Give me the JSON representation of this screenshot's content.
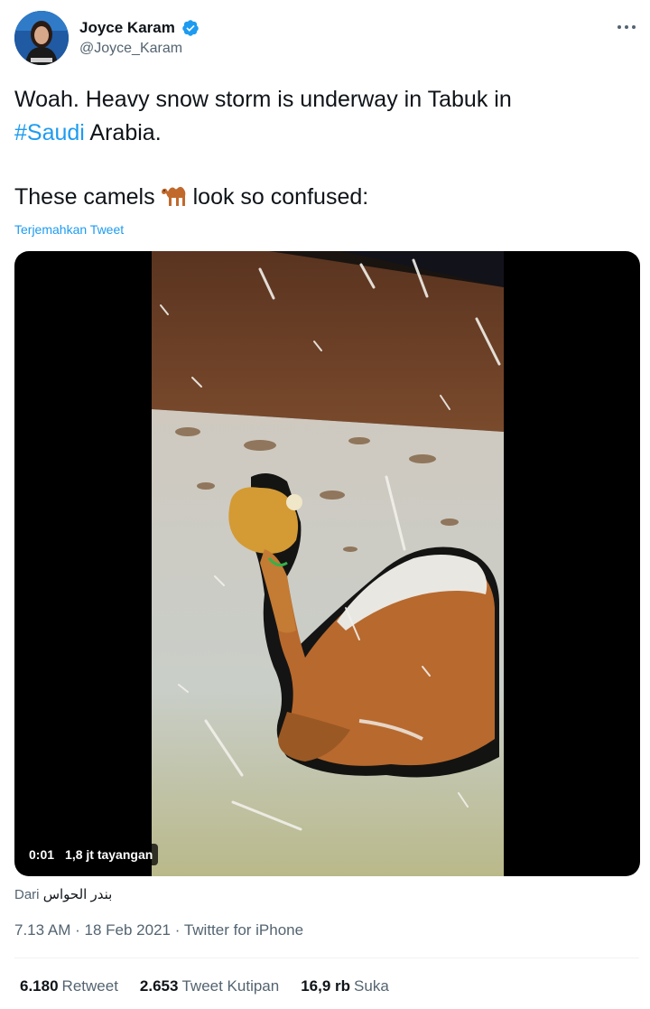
{
  "user": {
    "display_name": "Joyce Karam",
    "handle": "@Joyce_Karam"
  },
  "tweet": {
    "line1": "Woah. Heavy snow storm is underway in Tabuk in",
    "hashtag": "#Saudi",
    "line2_rest": " Arabia.",
    "line3_start": "These camels",
    "line3_end": "look so confused:",
    "translate_label": "Terjemahkan Tweet"
  },
  "media": {
    "timestamp": "0:01",
    "views": "1,8 jt tayangan"
  },
  "source": {
    "prefix": "Dari",
    "author": "بندر الحواس"
  },
  "meta": {
    "time": "7.13 AM",
    "date": "18 Feb 2021",
    "client": "Twitter for iPhone"
  },
  "stats": {
    "retweets": "6.180",
    "retweets_label": "Retweet",
    "quotes": "2.653",
    "quotes_label": "Tweet Kutipan",
    "likes": "16,9 rb",
    "likes_label": "Suka"
  },
  "icons": {
    "verified": "verified-badge-icon",
    "more": "more-options-icon",
    "camel": "camel-emoji-icon"
  },
  "colors": {
    "accent": "#1d9bf0",
    "text": "#0f1419",
    "secondary": "#536471"
  }
}
